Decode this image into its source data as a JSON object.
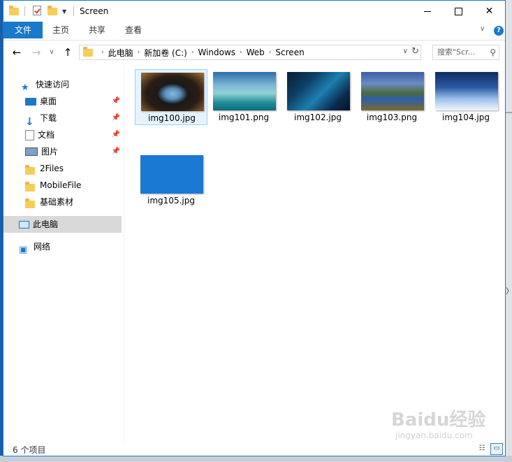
{
  "window": {
    "title": "Screen"
  },
  "ribbon": {
    "tabs": [
      "文件",
      "主页",
      "共享",
      "查看"
    ]
  },
  "address": {
    "crumbs": [
      "此电脑",
      "新加卷 (C:)",
      "Windows",
      "Web",
      "Screen"
    ],
    "search_placeholder": "搜索\"Scr..."
  },
  "sidebar": {
    "quick_access": "快速访问",
    "pinned": [
      "桌面",
      "下载",
      "文档",
      "图片"
    ],
    "folders": [
      "2Files",
      "MobileFile",
      "基础素材"
    ],
    "this_pc": "此电脑",
    "network": "网络"
  },
  "files": [
    "img100.jpg",
    "img101.png",
    "img102.jpg",
    "img103.png",
    "img104.jpg",
    "img105.jpg"
  ],
  "status": {
    "count": "6 个项目"
  },
  "watermark": {
    "brand": "Baidu经验",
    "url": "jingyan.baidu.com"
  },
  "colors": {
    "accent": "#1979ca",
    "selected_bg": "#e5f3ff",
    "nav_selected": "#d9d9d9"
  }
}
